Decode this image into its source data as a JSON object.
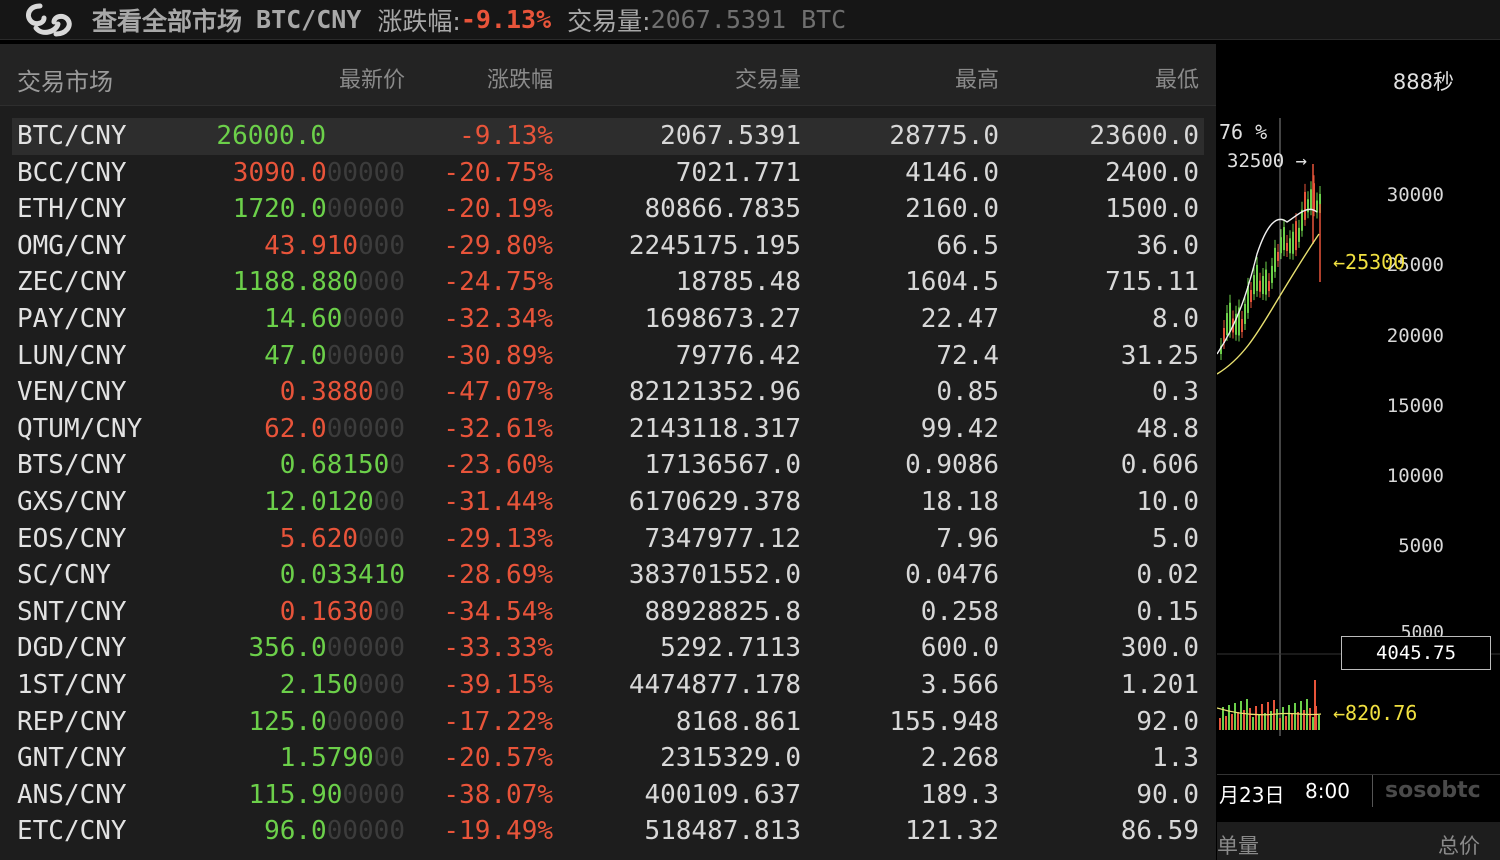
{
  "header": {
    "title": "查看全部市场",
    "pair": "BTC/CNY",
    "change_label": "涨跌幅:",
    "change_value": "-9.13%",
    "volume_label": "交易量:",
    "volume_value": "2067.5391 BTC"
  },
  "market": {
    "columns": {
      "market": "交易市场",
      "last": "最新价",
      "change": "涨跌幅",
      "volume": "交易量",
      "high": "最高",
      "low": "最低"
    },
    "rows": [
      {
        "pair": "BTC/CNY",
        "last": "26000.0",
        "pad": "",
        "change": "-9.13%",
        "volume": "2067.5391",
        "high": "28775.0",
        "low": "23600.0",
        "dir": "up"
      },
      {
        "pair": "BCC/CNY",
        "last": "3090.0",
        "pad": "00000",
        "change": "-20.75%",
        "volume": "7021.771",
        "high": "4146.0",
        "low": "2400.0",
        "dir": "down"
      },
      {
        "pair": "ETH/CNY",
        "last": "1720.0",
        "pad": "00000",
        "change": "-20.19%",
        "volume": "80866.7835",
        "high": "2160.0",
        "low": "1500.0",
        "dir": "up"
      },
      {
        "pair": "OMG/CNY",
        "last": "43.910",
        "pad": "000",
        "change": "-29.80%",
        "volume": "2245175.195",
        "high": "66.5",
        "low": "36.0",
        "dir": "down"
      },
      {
        "pair": "ZEC/CNY",
        "last": "1188.880",
        "pad": "000",
        "change": "-24.75%",
        "volume": "18785.48",
        "high": "1604.5",
        "low": "715.11",
        "dir": "up"
      },
      {
        "pair": "PAY/CNY",
        "last": "14.60",
        "pad": "0000",
        "change": "-32.34%",
        "volume": "1698673.27",
        "high": "22.47",
        "low": "8.0",
        "dir": "up"
      },
      {
        "pair": "LUN/CNY",
        "last": "47.0",
        "pad": "00000",
        "change": "-30.89%",
        "volume": "79776.42",
        "high": "72.4",
        "low": "31.25",
        "dir": "up"
      },
      {
        "pair": "VEN/CNY",
        "last": "0.3880",
        "pad": "00",
        "change": "-47.07%",
        "volume": "82121352.96",
        "high": "0.85",
        "low": "0.3",
        "dir": "down"
      },
      {
        "pair": "QTUM/CNY",
        "last": "62.0",
        "pad": "00000",
        "change": "-32.61%",
        "volume": "2143118.317",
        "high": "99.42",
        "low": "48.8",
        "dir": "down"
      },
      {
        "pair": "BTS/CNY",
        "last": "0.68150",
        "pad": "0",
        "change": "-23.60%",
        "volume": "17136567.0",
        "high": "0.9086",
        "low": "0.606",
        "dir": "up"
      },
      {
        "pair": "GXS/CNY",
        "last": "12.0120",
        "pad": "00",
        "change": "-31.44%",
        "volume": "6170629.378",
        "high": "18.18",
        "low": "10.0",
        "dir": "up"
      },
      {
        "pair": "EOS/CNY",
        "last": "5.620",
        "pad": "000",
        "change": "-29.13%",
        "volume": "7347977.12",
        "high": "7.96",
        "low": "5.0",
        "dir": "down"
      },
      {
        "pair": "SC/CNY",
        "last": "0.033410",
        "pad": "",
        "change": "-28.69%",
        "volume": "383701552.0",
        "high": "0.0476",
        "low": "0.02",
        "dir": "up"
      },
      {
        "pair": "SNT/CNY",
        "last": "0.1630",
        "pad": "00",
        "change": "-34.54%",
        "volume": "88928825.8",
        "high": "0.258",
        "low": "0.15",
        "dir": "down"
      },
      {
        "pair": "DGD/CNY",
        "last": "356.0",
        "pad": "00000",
        "change": "-33.33%",
        "volume": "5292.7113",
        "high": "600.0",
        "low": "300.0",
        "dir": "up"
      },
      {
        "pair": "1ST/CNY",
        "last": "2.150",
        "pad": "000",
        "change": "-39.15%",
        "volume": "4474877.178",
        "high": "3.566",
        "low": "1.201",
        "dir": "up"
      },
      {
        "pair": "REP/CNY",
        "last": "125.0",
        "pad": "00000",
        "change": "-17.22%",
        "volume": "8168.861",
        "high": "155.948",
        "low": "92.0",
        "dir": "up"
      },
      {
        "pair": "GNT/CNY",
        "last": "1.5790",
        "pad": "00",
        "change": "-20.57%",
        "volume": "2315329.0",
        "high": "2.268",
        "low": "1.3",
        "dir": "up"
      },
      {
        "pair": "ANS/CNY",
        "last": "115.90",
        "pad": "0000",
        "change": "-38.07%",
        "volume": "400109.637",
        "high": "189.3",
        "low": "90.0",
        "dir": "up"
      },
      {
        "pair": "ETC/CNY",
        "last": "96.0",
        "pad": "00000",
        "change": "-19.49%",
        "volume": "518487.813",
        "high": "121.32",
        "low": "86.59",
        "dir": "up"
      }
    ]
  },
  "chart_panel": {
    "timer": "888秒",
    "pct_label": "76 %",
    "high_label": "32500 →",
    "y_ticks": [
      "30000",
      "25000",
      "20000",
      "15000",
      "10000",
      "5000"
    ],
    "last_price_marker": "←25300",
    "volume_tick": "5000",
    "volume_value": "4045.75",
    "volume_marker": "←820.76",
    "date": "月23日",
    "time": "8:00",
    "brand": "sosobtc",
    "bottom_qty": "单量",
    "bottom_total": "总价",
    "colors": {
      "up": "#6cd04a",
      "down": "#e8543a",
      "ma_white": "#f0f0f0",
      "ma_yellow": "#e8e070"
    }
  }
}
